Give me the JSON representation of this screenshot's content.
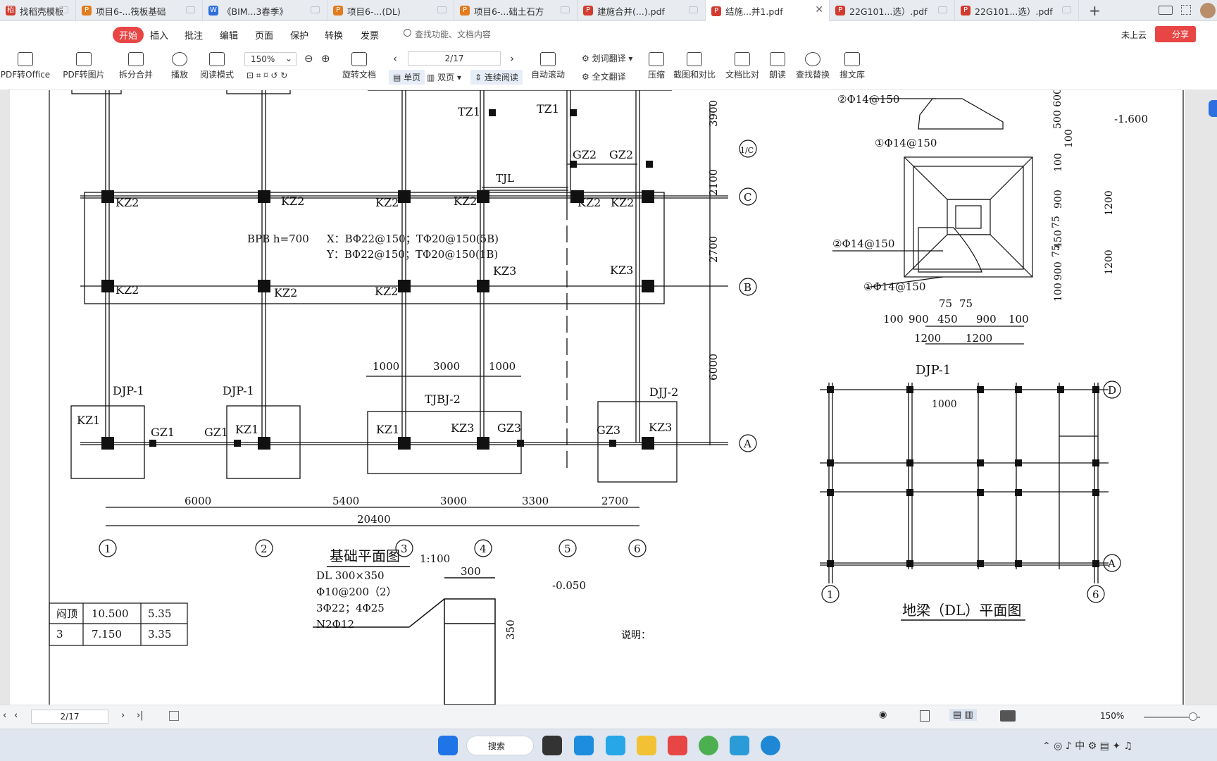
{
  "tabs": [
    {
      "label": "找稻壳模板",
      "color": "#d23c2e",
      "glyph": "稻"
    },
    {
      "label": "项目6-...筏板基础",
      "color": "#e47b1d",
      "glyph": "P"
    },
    {
      "label": "《BIM...3春季》",
      "color": "#2d6fe0",
      "glyph": "W"
    },
    {
      "label": "项目6-...(DL)",
      "color": "#e47b1d",
      "glyph": "P"
    },
    {
      "label": "项目6-...础土石方",
      "color": "#e47b1d",
      "glyph": "P"
    },
    {
      "label": "建施合并(...).pdf",
      "color": "#d23c2e",
      "glyph": "P"
    },
    {
      "label": "结施...并1.pdf",
      "color": "#d23c2e",
      "glyph": "P"
    },
    {
      "label": "22G101...选）.pdf",
      "color": "#d23c2e",
      "glyph": "P"
    },
    {
      "label": "22G101...选）.pdf",
      "color": "#d23c2e",
      "glyph": "P"
    }
  ],
  "menu": {
    "items": [
      "开始",
      "插入",
      "批注",
      "编辑",
      "页面",
      "保护",
      "转换",
      "发票"
    ],
    "search_placeholder": "查找功能、文档内容",
    "cloud": "未上云",
    "share": "分享"
  },
  "toolbar": {
    "pdf_to_office": "PDF转Office",
    "pdf_to_image": "PDF转图片",
    "split_merge": "拆分合并",
    "play": "播放",
    "read_mode": "阅读模式",
    "zoom": "150%",
    "rotate": "旋转文档",
    "page": "2/17",
    "single": "单页",
    "double": "双页",
    "continuous": "连续阅读",
    "autoscroll": "自动滚动",
    "translate_word": "划词翻译",
    "translate_full": "全文翻译",
    "compress": "压缩",
    "screenshot_compare": "截图和对比",
    "doc_compare": "文档比对",
    "read_aloud": "朗读",
    "find_replace": "查找替换",
    "search_lib": "搜文库"
  },
  "drawing": {
    "plan_title": "基础平面图",
    "plan_scale": "1:100",
    "beam_plan_title": "地梁（DL）平面图",
    "section_title": "DJP-1",
    "raft_note1": "BPB h=700",
    "raft_note2": "X：BΦ22@150；TΦ20@150(5B)",
    "raft_note3": "Y：BΦ22@150；TΦ20@150(1B)",
    "dl_spec": [
      "DL 300×350",
      "Φ10@200（2）",
      "3Φ22；4Φ25",
      "N2Φ12"
    ],
    "level_top": "-1.600",
    "level_dl": "-0.050",
    "note_label": "说明：",
    "axes_h": [
      "1",
      "2",
      "3",
      "4",
      "5",
      "6"
    ],
    "axes_v": [
      "A",
      "B",
      "C",
      "1/C"
    ],
    "spans": [
      "6000",
      "5400",
      "3000",
      "3300",
      "2700"
    ],
    "total_span": "20400",
    "vert_dims": [
      "3900",
      "2100",
      "2700",
      "6000"
    ],
    "table": [
      [
        "闷顶",
        "10.500",
        "5.35"
      ],
      [
        "3",
        "7.150",
        "3.35"
      ]
    ]
  },
  "status": {
    "page": "2/17",
    "zoom": "150%"
  },
  "taskbar": {
    "search": "搜索"
  }
}
